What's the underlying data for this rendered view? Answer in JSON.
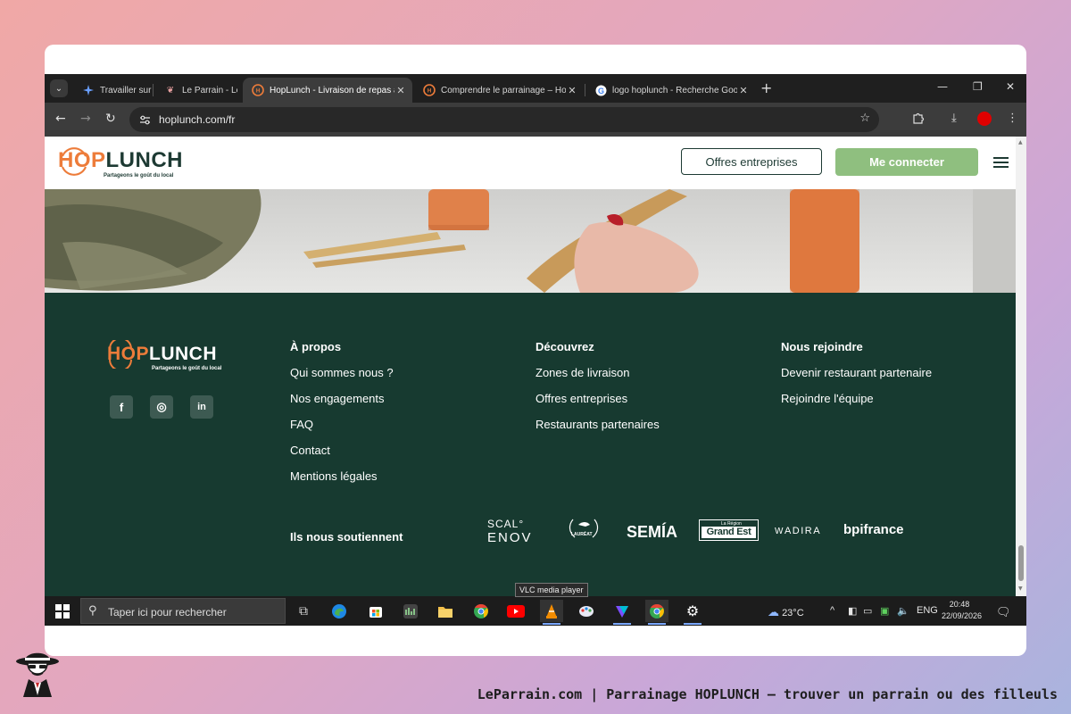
{
  "browser": {
    "tabs": [
      {
        "title": "Travailler sur l",
        "favicon": "sparkle-icon",
        "active": false
      },
      {
        "title": "Le Parrain - Le",
        "favicon": "leparrain-icon",
        "active": false
      },
      {
        "title": "HopLunch - Livraison de repas à",
        "favicon": "hoplunch-icon",
        "active": true
      },
      {
        "title": "Comprendre le parrainage – Ho",
        "favicon": "hoplunch-icon",
        "active": false
      },
      {
        "title": "logo hoplunch - Recherche Goo",
        "favicon": "google-icon",
        "active": false
      }
    ],
    "url": "hoplunch.com/fr"
  },
  "site": {
    "logo": {
      "hop": "HOP",
      "lunch": "LUNCH",
      "tagline": "Partageons le goût du local"
    },
    "header": {
      "offers_button": "Offres entreprises",
      "login_button": "Me connecter"
    },
    "footer": {
      "social": [
        {
          "name": "facebook-icon",
          "glyph": "f"
        },
        {
          "name": "instagram-icon",
          "glyph": "◎"
        },
        {
          "name": "linkedin-icon",
          "glyph": "in"
        }
      ],
      "columns": [
        {
          "heading": "À propos",
          "links": [
            "Qui sommes nous ?",
            "Nos engagements",
            "FAQ",
            "Contact",
            "Mentions légales"
          ]
        },
        {
          "heading": "Découvrez",
          "links": [
            "Zones de livraison",
            "Offres entreprises",
            "Restaurants partenaires"
          ]
        },
        {
          "heading": "Nous rejoindre",
          "links": [
            "Devenir restaurant partenaire",
            "Rejoindre l'équipe"
          ]
        }
      ],
      "sponsors_title": "Ils nous soutiennent",
      "sponsors": {
        "scalenov_top": "SCAL°",
        "scalenov_bottom": "ENOV",
        "laureat": "LAURÉAT",
        "semia": "SEMÍA",
        "grandest_small": "La Région",
        "grandest": "Grand Est",
        "adira": "ADIRA",
        "bpifrance": "bpifrance"
      }
    }
  },
  "tooltip": "VLC media player",
  "taskbar": {
    "search_placeholder": "Taper ici pour rechercher",
    "weather": "23°C",
    "language": "ENG",
    "time": "20:48",
    "date": "22/09/2026"
  },
  "caption": "LeParrain.com | Parrainage HOPLUNCH — trouver un parrain ou des filleuls",
  "colors": {
    "brand_orange": "#ed7c3a",
    "brand_dark": "#173a30",
    "login_green": "#8fbf7f"
  }
}
